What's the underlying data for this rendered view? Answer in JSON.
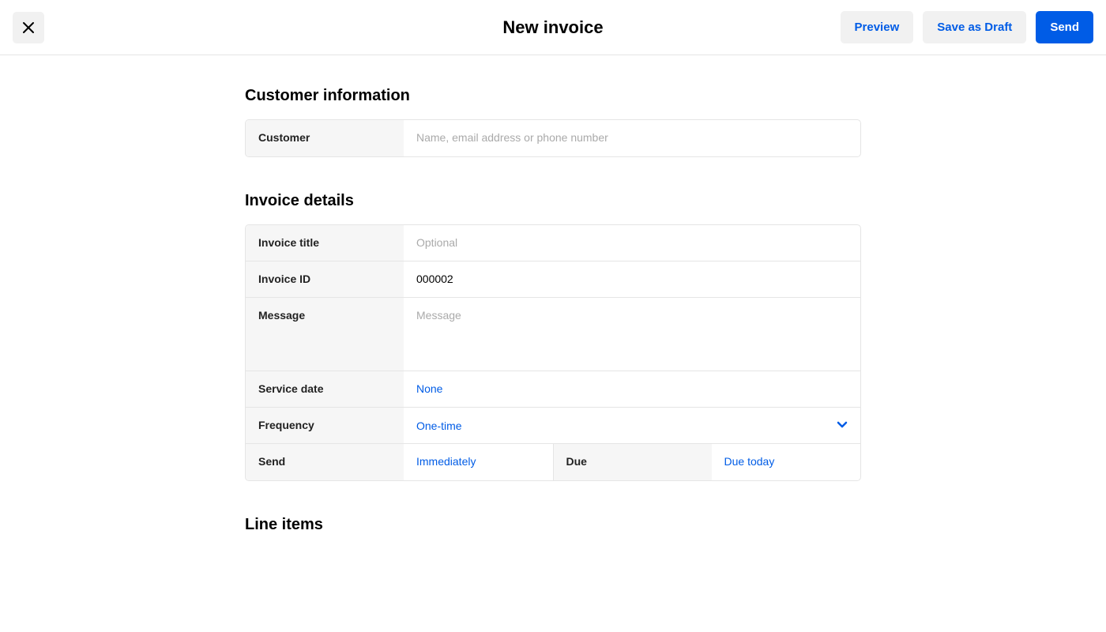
{
  "header": {
    "title": "New invoice",
    "preview_label": "Preview",
    "draft_label": "Save as Draft",
    "send_label": "Send"
  },
  "sections": {
    "customer_info_title": "Customer information",
    "invoice_details_title": "Invoice details",
    "line_items_title": "Line items"
  },
  "customer": {
    "label": "Customer",
    "placeholder": "Name, email address or phone number",
    "value": ""
  },
  "invoice": {
    "title_label": "Invoice title",
    "title_placeholder": "Optional",
    "title_value": "",
    "id_label": "Invoice ID",
    "id_value": "000002",
    "message_label": "Message",
    "message_placeholder": "Message",
    "message_value": "",
    "service_date_label": "Service date",
    "service_date_value": "None",
    "frequency_label": "Frequency",
    "frequency_value": "One-time",
    "send_label": "Send",
    "send_value": "Immediately",
    "due_label": "Due",
    "due_value": "Due today"
  }
}
